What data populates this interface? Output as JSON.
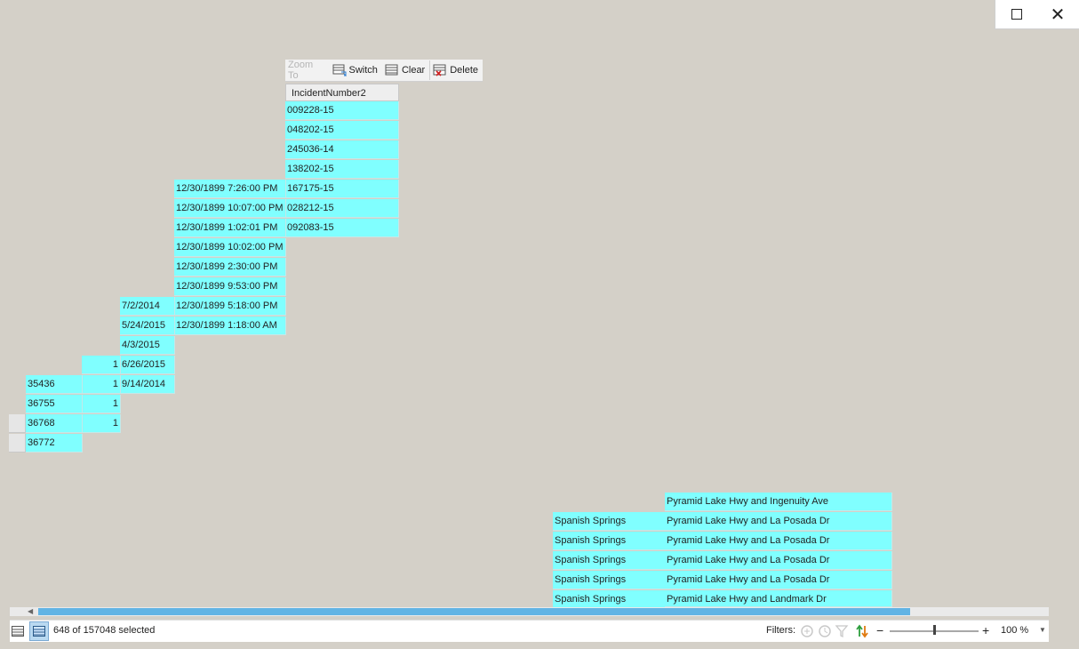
{
  "toolbar": {
    "zoom_to": "Zoom To",
    "switch": "Switch",
    "clear": "Clear",
    "delete": "Delete"
  },
  "incident_column": {
    "header": "IncidentNumber2",
    "values": [
      "009228-15",
      "048202-15",
      "245036-14",
      "138202-15",
      "167175-15",
      "028212-15",
      "092083-15"
    ]
  },
  "time_column": {
    "values": [
      "12/30/1899 7:26:00 PM",
      "12/30/1899 10:07:00 PM",
      "12/30/1899 1:02:01 PM",
      "12/30/1899 10:02:00 PM",
      "12/30/1899 2:30:00 PM",
      "12/30/1899 9:53:00 PM",
      "12/30/1899 5:18:00 PM",
      "12/30/1899 1:18:00 AM"
    ]
  },
  "date_column": {
    "values": [
      "7/2/2014",
      "5/24/2015",
      "4/3/2015",
      "6/26/2015",
      "9/14/2014"
    ]
  },
  "count_column": {
    "values": [
      "1",
      "1",
      "1",
      "1"
    ]
  },
  "id_column": {
    "values": [
      "35436",
      "36755",
      "36768",
      "36772"
    ]
  },
  "area_column": {
    "values": [
      "Spanish Springs",
      "Spanish Springs",
      "Spanish Springs",
      "Spanish Springs",
      "Spanish Springs"
    ]
  },
  "location_column": {
    "values": [
      "Pyramid Lake Hwy and Ingenuity Ave",
      "Pyramid Lake Hwy and La Posada Dr",
      "Pyramid Lake Hwy and La Posada Dr",
      "Pyramid Lake Hwy and La Posada Dr",
      "Pyramid Lake Hwy and La Posada Dr",
      "Pyramid Lake Hwy and Landmark Dr"
    ]
  },
  "status": {
    "selection": "648 of 157048 selected",
    "filters_label": "Filters:",
    "zoom": "100 %",
    "zoom_level": 0.5
  },
  "icons": {
    "maximize": "maximize-icon",
    "close": "close-icon",
    "switch": "switch-selection-icon",
    "clear": "clear-selection-icon",
    "delete": "delete-rows-icon",
    "show_all": "show-all-records-icon",
    "show_selected": "show-selected-records-icon",
    "filter_extent": "filter-by-extent-icon",
    "filter_time": "filter-by-time-icon",
    "filter_range": "filter-by-range-icon",
    "sort": "sort-icon"
  },
  "colors": {
    "selected_row": "#80ffff",
    "background": "#d4d0c8",
    "scroll_thumb": "#62b4e4"
  }
}
